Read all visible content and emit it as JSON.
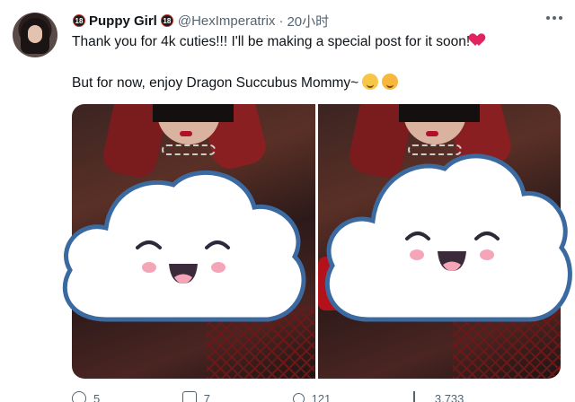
{
  "tweet": {
    "display_name": "Puppy Girl",
    "badge_text": "18",
    "handle": "@HexImperatrix",
    "separator": "·",
    "time": "20小时",
    "line1": "Thank you for 4k cuties!!! I'll be making a special post for it soon!",
    "line2": "But for now, enjoy Dragon Succubus Mommy~"
  },
  "actions": {
    "replies": "5",
    "retweets": "7",
    "likes": "121",
    "views": "3,733"
  },
  "colors": {
    "text": "#0f1419",
    "secondary": "#536471",
    "cloud_outline": "#3b6aa0",
    "cheek": "#f4a6b8"
  },
  "icons": [
    "more-icon",
    "heart-icon",
    "smile-emoji-icon",
    "hug-emoji-icon",
    "reply-icon",
    "retweet-icon",
    "like-icon",
    "views-icon",
    "share-icon"
  ]
}
